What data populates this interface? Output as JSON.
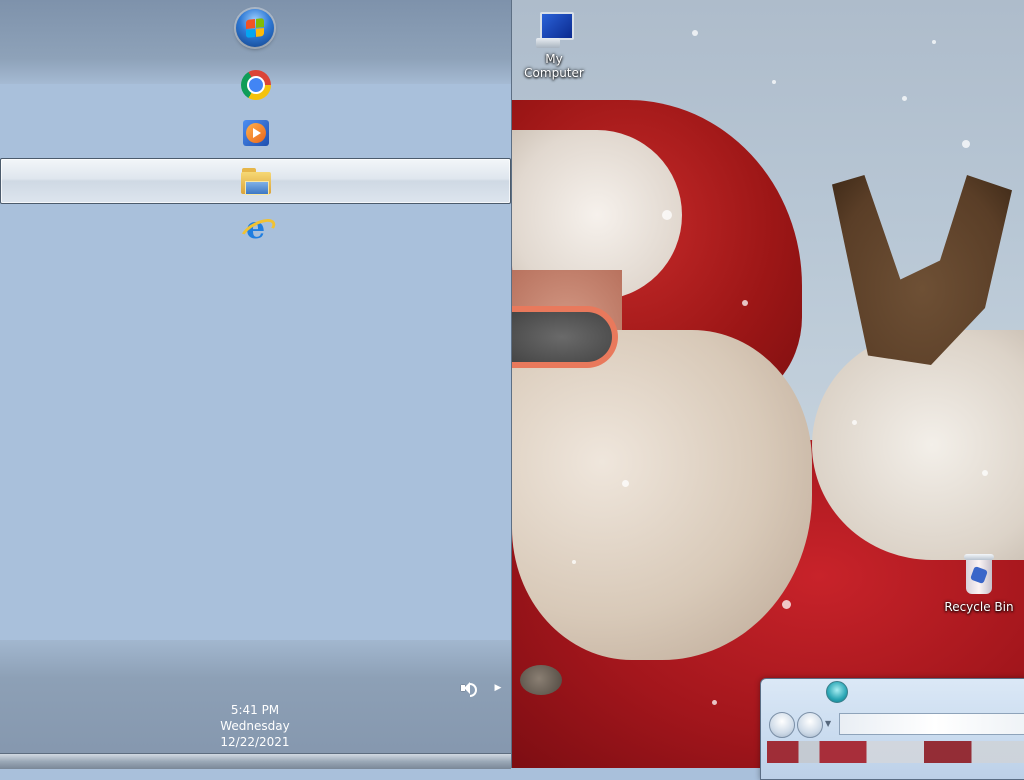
{
  "desktop": {
    "icons": [
      {
        "label": "My Computer",
        "icon": "computer-icon"
      },
      {
        "label": "Recycle Bin",
        "icon": "recycle-bin-icon"
      }
    ]
  },
  "taskbar": {
    "orientation": "vertical-left",
    "start_button": {
      "icon": "windows-start-orb-icon"
    },
    "pinned": [
      {
        "icon": "chrome-icon",
        "active": false
      },
      {
        "icon": "windows-media-player-icon",
        "active": false
      },
      {
        "icon": "windows-explorer-folder-icon",
        "active": true
      },
      {
        "icon": "internet-explorer-icon",
        "active": false
      }
    ],
    "tray": {
      "icons": [
        "speaker-icon",
        "expand-arrow-icon"
      ],
      "clock": {
        "time": "5:41 PM",
        "day": "Wednesday",
        "date": "12/22/2021"
      }
    }
  },
  "explorer_window": {
    "icon": "explorer-window-icon",
    "address": ""
  },
  "colors": {
    "taskbar": "#a9c0db",
    "taskbar_top": "#8ea2b9",
    "active_button": "#dfe6ee",
    "wallpaper_red": "#b01b22"
  }
}
